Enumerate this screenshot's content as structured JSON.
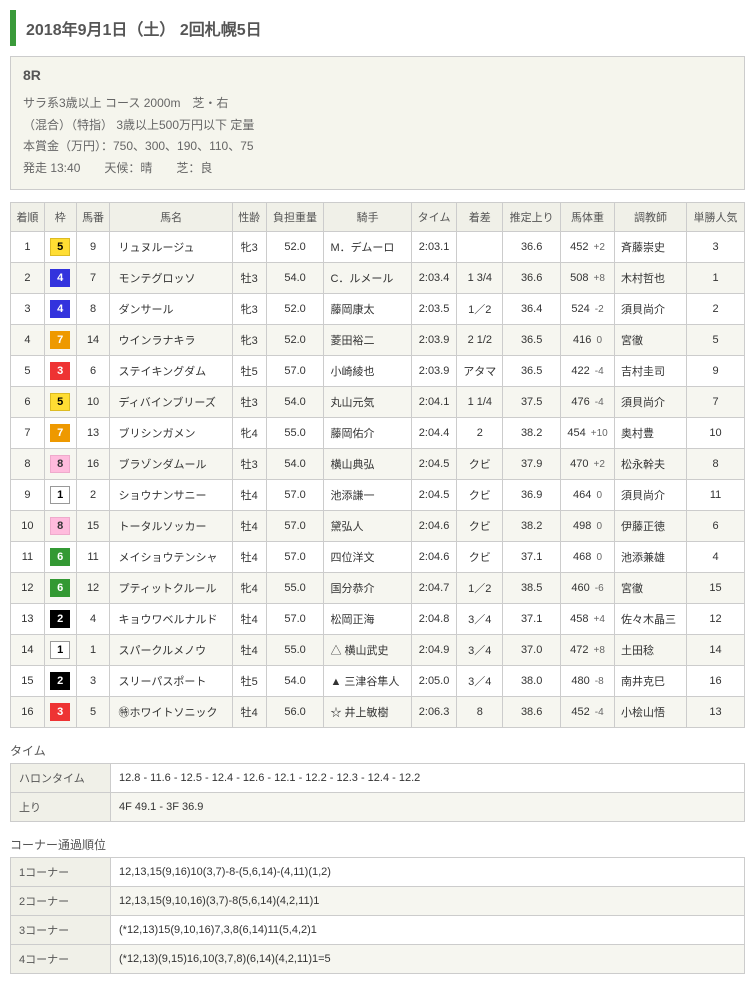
{
  "header": {
    "title": "2018年9月1日（土） 2回札幌5日"
  },
  "race": {
    "number": "8R",
    "line1": "サラ系3歳以上 コース 2000m　芝・右",
    "line2": "（混合）（特指） 3歳以上500万円以下 定量",
    "line3": "本賞金（万円）：750、300、190、110、75",
    "line4": "発走 13:40　　天候：晴　　芝：良"
  },
  "columns": [
    "着順",
    "枠",
    "馬番",
    "馬名",
    "性齢",
    "負担重量",
    "騎手",
    "タイム",
    "着差",
    "推定上り",
    "馬体重",
    "調教師",
    "単勝人気"
  ],
  "rows": [
    {
      "rank": "1",
      "waku": "5",
      "num": "9",
      "name": "リュヌルージュ",
      "sa": "牝3",
      "wt": "52.0",
      "jockey": "M．デムーロ",
      "time": "2:03.1",
      "margin": "",
      "agari": "36.6",
      "bw": "452",
      "bwd": "+2",
      "trainer": "斉藤崇史",
      "pop": "3"
    },
    {
      "rank": "2",
      "waku": "4",
      "num": "7",
      "name": "モンテグロッソ",
      "sa": "牡3",
      "wt": "54.0",
      "jockey": "C．ルメール",
      "time": "2:03.4",
      "margin": "1 3/4",
      "agari": "36.6",
      "bw": "508",
      "bwd": "+8",
      "trainer": "木村哲也",
      "pop": "1"
    },
    {
      "rank": "3",
      "waku": "4",
      "num": "8",
      "name": "ダンサール",
      "sa": "牝3",
      "wt": "52.0",
      "jockey": "藤岡康太",
      "time": "2:03.5",
      "margin": "1／2",
      "agari": "36.4",
      "bw": "524",
      "bwd": "-2",
      "trainer": "須貝尚介",
      "pop": "2"
    },
    {
      "rank": "4",
      "waku": "7",
      "num": "14",
      "name": "ウインラナキラ",
      "sa": "牝3",
      "wt": "52.0",
      "jockey": "菱田裕二",
      "time": "2:03.9",
      "margin": "2 1/2",
      "agari": "36.5",
      "bw": "416",
      "bwd": "0",
      "trainer": "宮徹",
      "pop": "5"
    },
    {
      "rank": "5",
      "waku": "3",
      "num": "6",
      "name": "ステイキングダム",
      "sa": "牡5",
      "wt": "57.0",
      "jockey": "小崎綾也",
      "time": "2:03.9",
      "margin": "アタマ",
      "agari": "36.5",
      "bw": "422",
      "bwd": "-4",
      "trainer": "吉村圭司",
      "pop": "9"
    },
    {
      "rank": "6",
      "waku": "5",
      "num": "10",
      "name": "ディバインブリーズ",
      "sa": "牡3",
      "wt": "54.0",
      "jockey": "丸山元気",
      "time": "2:04.1",
      "margin": "1 1/4",
      "agari": "37.5",
      "bw": "476",
      "bwd": "-4",
      "trainer": "須貝尚介",
      "pop": "7"
    },
    {
      "rank": "7",
      "waku": "7",
      "num": "13",
      "name": "ブリシンガメン",
      "sa": "牝4",
      "wt": "55.0",
      "jockey": "藤岡佑介",
      "time": "2:04.4",
      "margin": "2",
      "agari": "38.2",
      "bw": "454",
      "bwd": "+10",
      "trainer": "奥村豊",
      "pop": "10"
    },
    {
      "rank": "8",
      "waku": "8",
      "num": "16",
      "name": "ブラゾンダムール",
      "sa": "牡3",
      "wt": "54.0",
      "jockey": "横山典弘",
      "time": "2:04.5",
      "margin": "クビ",
      "agari": "37.9",
      "bw": "470",
      "bwd": "+2",
      "trainer": "松永幹夫",
      "pop": "8"
    },
    {
      "rank": "9",
      "waku": "1",
      "num": "2",
      "name": "ショウナンサニー",
      "sa": "牡4",
      "wt": "57.0",
      "jockey": "池添謙一",
      "time": "2:04.5",
      "margin": "クビ",
      "agari": "36.9",
      "bw": "464",
      "bwd": "0",
      "trainer": "須貝尚介",
      "pop": "11"
    },
    {
      "rank": "10",
      "waku": "8",
      "num": "15",
      "name": "トータルソッカー",
      "sa": "牡4",
      "wt": "57.0",
      "jockey": "黛弘人",
      "time": "2:04.6",
      "margin": "クビ",
      "agari": "38.2",
      "bw": "498",
      "bwd": "0",
      "trainer": "伊藤正徳",
      "pop": "6"
    },
    {
      "rank": "11",
      "waku": "6",
      "num": "11",
      "name": "メイショウテンシャ",
      "sa": "牡4",
      "wt": "57.0",
      "jockey": "四位洋文",
      "time": "2:04.6",
      "margin": "クビ",
      "agari": "37.1",
      "bw": "468",
      "bwd": "0",
      "trainer": "池添兼雄",
      "pop": "4"
    },
    {
      "rank": "12",
      "waku": "6",
      "num": "12",
      "name": "プティットクルール",
      "sa": "牝4",
      "wt": "55.0",
      "jockey": "国分恭介",
      "time": "2:04.7",
      "margin": "1／2",
      "agari": "38.5",
      "bw": "460",
      "bwd": "-6",
      "trainer": "宮徹",
      "pop": "15"
    },
    {
      "rank": "13",
      "waku": "2",
      "num": "4",
      "name": "キョウワベルナルド",
      "sa": "牡4",
      "wt": "57.0",
      "jockey": "松岡正海",
      "time": "2:04.8",
      "margin": "3／4",
      "agari": "37.1",
      "bw": "458",
      "bwd": "+4",
      "trainer": "佐々木晶三",
      "pop": "12"
    },
    {
      "rank": "14",
      "waku": "1",
      "num": "1",
      "name": "スパークルメノウ",
      "sa": "牡4",
      "wt": "55.0",
      "jockey": "△ 横山武史",
      "time": "2:04.9",
      "margin": "3／4",
      "agari": "37.0",
      "bw": "472",
      "bwd": "+8",
      "trainer": "土田稔",
      "pop": "14"
    },
    {
      "rank": "15",
      "waku": "2",
      "num": "3",
      "name": "スリーパスポート",
      "sa": "牡5",
      "wt": "54.0",
      "jockey": "▲ 三津谷隼人",
      "time": "2:05.0",
      "margin": "3／4",
      "agari": "38.0",
      "bw": "480",
      "bwd": "-8",
      "trainer": "南井克巳",
      "pop": "16"
    },
    {
      "rank": "16",
      "waku": "3",
      "num": "5",
      "name": "㊕ホワイトソニック",
      "sa": "牡4",
      "wt": "56.0",
      "jockey": "☆ 井上敏樹",
      "time": "2:06.3",
      "margin": "8",
      "agari": "38.6",
      "bw": "452",
      "bwd": "-4",
      "trainer": "小桧山悟",
      "pop": "13"
    }
  ],
  "time_section": {
    "title": "タイム",
    "halon_label": "ハロンタイム",
    "halon": "12.8 - 11.6 - 12.5 - 12.4 - 12.6 - 12.1 - 12.2 - 12.3 - 12.4 - 12.2",
    "agari_label": "上り",
    "agari": "4F 49.1 - 3F 36.9"
  },
  "corner_section": {
    "title": "コーナー通過順位",
    "rows": [
      {
        "label": "1コーナー",
        "val": "12,13,15(9,16)10(3,7)-8-(5,6,14)-(4,11)(1,2)"
      },
      {
        "label": "2コーナー",
        "val": "12,13,15(9,10,16)(3,7)-8(5,6,14)(4,2,11)1"
      },
      {
        "label": "3コーナー",
        "val": "(*12,13)15(9,10,16)7,3,8(6,14)11(5,4,2)1"
      },
      {
        "label": "4コーナー",
        "val": "(*12,13)(9,15)16,10(3,7,8)(6,14)(4,2,11)1=5"
      }
    ]
  }
}
